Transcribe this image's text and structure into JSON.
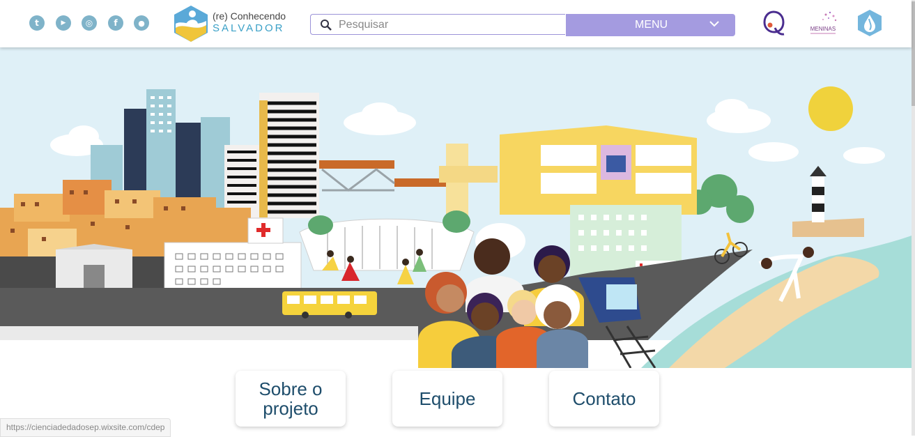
{
  "header": {
    "social": [
      {
        "name": "tumblr-icon",
        "glyph": "t"
      },
      {
        "name": "youtube-icon",
        "glyph": "▶"
      },
      {
        "name": "instagram-icon",
        "glyph": "◎"
      },
      {
        "name": "facebook-icon",
        "glyph": "f"
      },
      {
        "name": "github-icon",
        "glyph": "●"
      }
    ],
    "logo": {
      "line1": "(re) Conhecendo",
      "line2": "SALVADOR"
    },
    "search": {
      "placeholder": "Pesquisar"
    },
    "menu": {
      "label": "MENU"
    },
    "partners": [
      {
        "name": "partner-logo-q",
        "brand": "Q"
      },
      {
        "name": "partner-logo-meninas",
        "brand": "MENINAS"
      },
      {
        "name": "partner-logo-drop",
        "brand": "drop"
      }
    ],
    "colors": {
      "accent": "#a49be0",
      "social": "#7fb3c9",
      "brand_blue": "#3aa0c7"
    }
  },
  "hero": {
    "image": "salvador-city-illustration"
  },
  "nav_cards": [
    {
      "label": "Sobre o projeto"
    },
    {
      "label": "Equipe"
    },
    {
      "label": "Contato"
    }
  ],
  "status_bar": {
    "url": "https://cienciadedadosep.wixsite.com/cdep"
  }
}
